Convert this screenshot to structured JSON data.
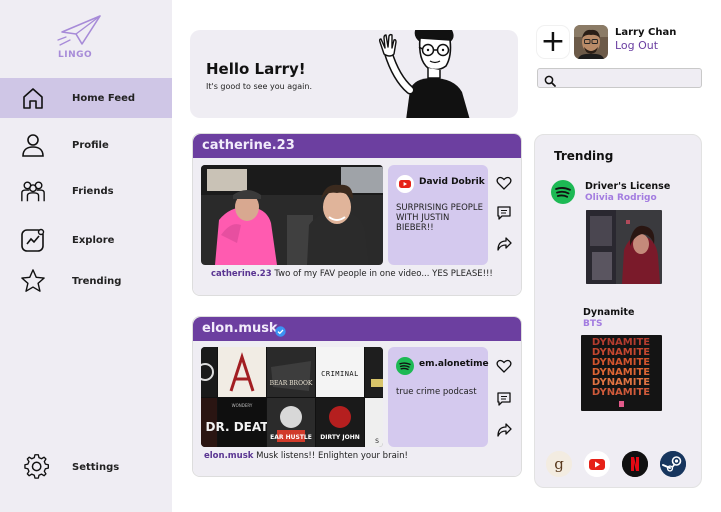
{
  "brand": {
    "name": "LINGO"
  },
  "nav": {
    "items": [
      {
        "label": "Home Feed",
        "icon": "home-icon",
        "active": true
      },
      {
        "label": "Profile",
        "icon": "user-icon"
      },
      {
        "label": "Friends",
        "icon": "friends-icon"
      },
      {
        "label": "Explore",
        "icon": "explore-icon"
      },
      {
        "label": "Trending",
        "icon": "star-icon"
      }
    ],
    "settings": {
      "label": "Settings",
      "icon": "gear-icon"
    }
  },
  "greeting": {
    "title": "Hello Larry!",
    "subtitle": "It's good to see you again."
  },
  "user": {
    "name": "Larry Chan",
    "logout_label": "Log Out",
    "add_label": "+"
  },
  "search": {
    "placeholder": "",
    "value": ""
  },
  "posts": [
    {
      "username": "catherine.23",
      "verified": false,
      "source_name": "David Dobrik",
      "source_icon": "youtube-icon",
      "description": "SURPRISING PEOPLE WITH JUSTIN BIEBER!!",
      "caption_user": "catherine.23",
      "caption_text": "Two of my FAV people in one video... YES PLEASE!!!"
    },
    {
      "username": "elon.musk",
      "verified": true,
      "source_name": "em.alonetime",
      "source_icon": "spotify-icon",
      "description": "true crime podcast",
      "caption_user": "elon.musk",
      "caption_text": "Musk listens!! Enlighten your brain!",
      "covers": [
        "CRIMINAL",
        "BEAR BROOK",
        "WONDERY",
        "DR. DEATH",
        "EAR HUSTLE",
        "DIRTY JOHN",
        "S"
      ]
    }
  ],
  "trending": {
    "title": "Trending",
    "songs": [
      {
        "title": "Driver's License",
        "artist": "Olivia Rodrigo"
      },
      {
        "title": "Dynamite",
        "artist": "BTS",
        "cover_text": "DYNAMITE"
      }
    ],
    "apps": [
      "goodreads-icon",
      "youtube-icon",
      "netflix-icon",
      "steam-icon"
    ]
  },
  "colors": {
    "accent": "#6c3fa0",
    "sidebar": "#efedf3",
    "active_nav": "#cfc6e6",
    "card_purple": "#d4c9ee",
    "artist": "#a37ce0"
  }
}
